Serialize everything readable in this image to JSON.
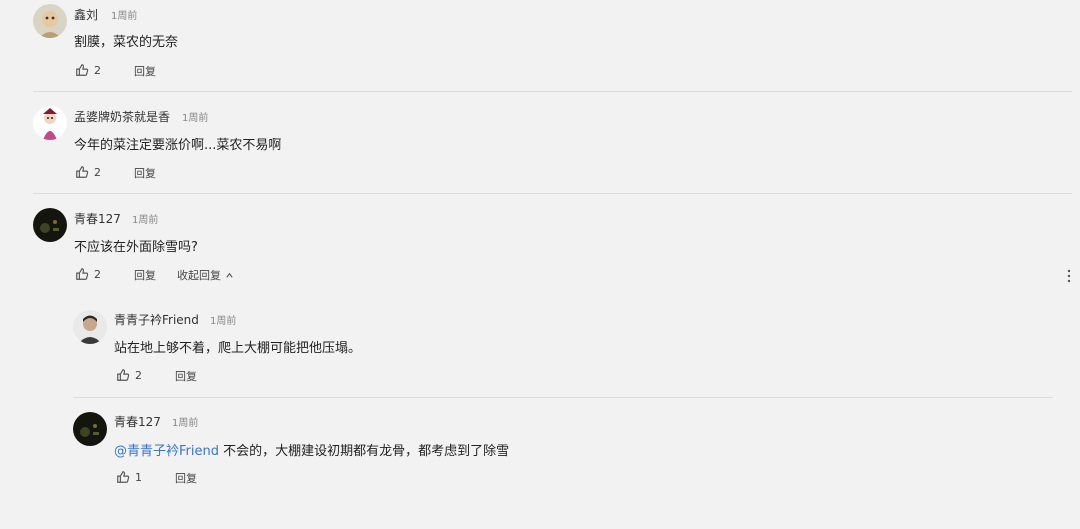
{
  "comments": [
    {
      "user": "鑫刘",
      "time": "1周前",
      "text": "割膜，菜农的无奈",
      "likes": "2",
      "reply": "回复"
    },
    {
      "user": "孟婆牌奶茶就是香",
      "time": "1周前",
      "text": "今年的菜注定要涨价啊...菜农不易啊",
      "likes": "2",
      "reply": "回复"
    },
    {
      "user": "青春127",
      "time": "1周前",
      "text": "不应该在外面除雪吗?",
      "likes": "2",
      "reply": "回复",
      "collapse": "收起回复"
    }
  ],
  "replies": [
    {
      "user": "青青子衿Friend",
      "time": "1周前",
      "text": "站在地上够不着，爬上大棚可能把他压塌。",
      "likes": "2",
      "reply": "回复"
    },
    {
      "user": "青春127",
      "time": "1周前",
      "mention": "@青青子衿Friend",
      "text": " 不会的，大棚建设初期都有龙骨，都考虑到了除雪",
      "likes": "1",
      "reply": "回复"
    }
  ],
  "icons": {
    "like": "thumbs-up-icon",
    "more": "more-vertical-icon",
    "collapse": "chevron-up-icon"
  },
  "colors": {
    "mention": "#3b74c8",
    "background": "#f2f2f2"
  }
}
